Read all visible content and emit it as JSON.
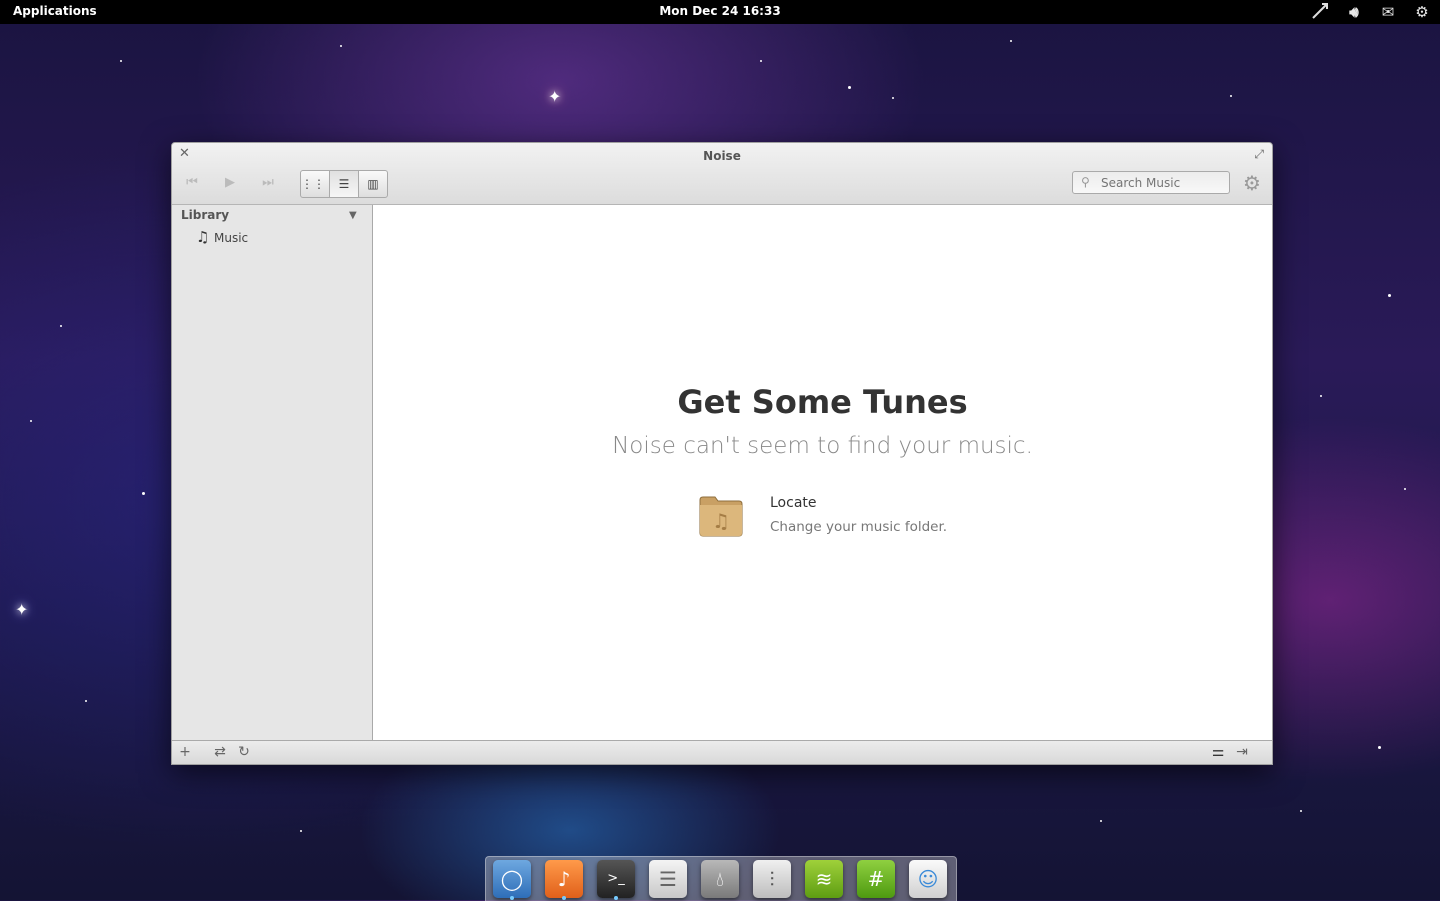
{
  "panel": {
    "applications": "Applications",
    "clock": "Mon Dec 24 16:33",
    "indicators": [
      "network-icon",
      "volume-icon",
      "mail-icon",
      "settings-icon"
    ]
  },
  "window": {
    "title": "Noise",
    "toolbar": {
      "buttons": [
        "previous-icon",
        "play-icon",
        "next-icon"
      ],
      "view_modes": [
        "grid-view-icon",
        "list-view-icon",
        "column-view-icon"
      ],
      "active_view": "list-view-icon",
      "search_placeholder": "Search Music"
    },
    "sidebar": {
      "section": "Library",
      "items": [
        {
          "label": "Music",
          "icon": "music-note-icon"
        }
      ]
    },
    "welcome": {
      "title": "Get Some Tunes",
      "subtitle": "Noise can't seem to find your music.",
      "options": [
        {
          "title": "Locate",
          "description": "Change your music folder.",
          "icon": "music-folder-icon"
        }
      ]
    },
    "bottom_bar": [
      "add-icon",
      "shuffle-icon",
      "repeat-icon",
      "equalizer-icon",
      "mini-mode-icon"
    ]
  },
  "dock": {
    "apps": [
      "midori-icon",
      "noise-icon",
      "terminal-icon",
      "files-icon",
      "scratch-icon",
      "settings-app-icon",
      "spotify-icon",
      "xchat-icon",
      "empathy-icon"
    ],
    "running": [
      "midori-icon",
      "noise-icon",
      "terminal-icon"
    ]
  },
  "colors": {
    "accent": "#f07a2a",
    "panel": "#000000",
    "window": "#e6e6e6"
  }
}
